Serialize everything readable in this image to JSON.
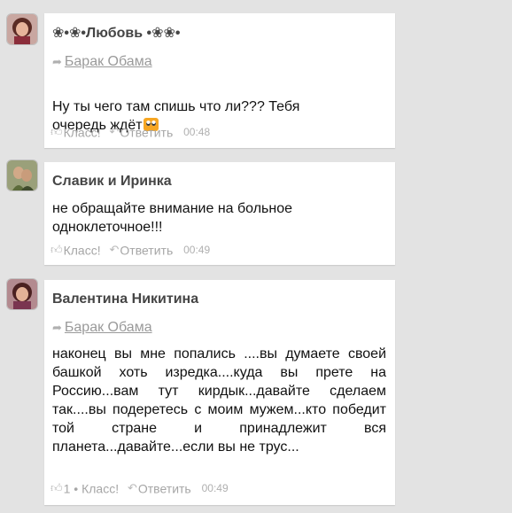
{
  "comments": [
    {
      "author": "❀•❀•Любовь •❀❀•",
      "reply_to": "Барак Обама",
      "text": "Ну ты чего там спишь что ли??? Тебя\nочередь ждёт",
      "emoji": "surprised-face-emoji",
      "like_label": "Класс!",
      "like_count": "",
      "reply_label": "Ответить",
      "time": "00:48"
    },
    {
      "author": "Славик и Иринка",
      "text": "не обращайте внимание на больное\nодноклеточное!!!",
      "like_label": "Класс!",
      "reply_label": "Ответить",
      "time": "00:49"
    },
    {
      "author": "Валентина Никитина",
      "reply_to": "Барак Обама",
      "text": "наконец вы мне попались ....вы думаете своей башкой хоть изредка....куда вы прете на Россию...вам тут кирдык...давайте сделаем так....вы подеретесь с моим мужем...кто победит той стране и принадлежит вся планета...давайте...если вы не трус...",
      "like_count": "1",
      "like_label": "Класс!",
      "reply_label": "Ответить",
      "time": "00:49"
    }
  ]
}
